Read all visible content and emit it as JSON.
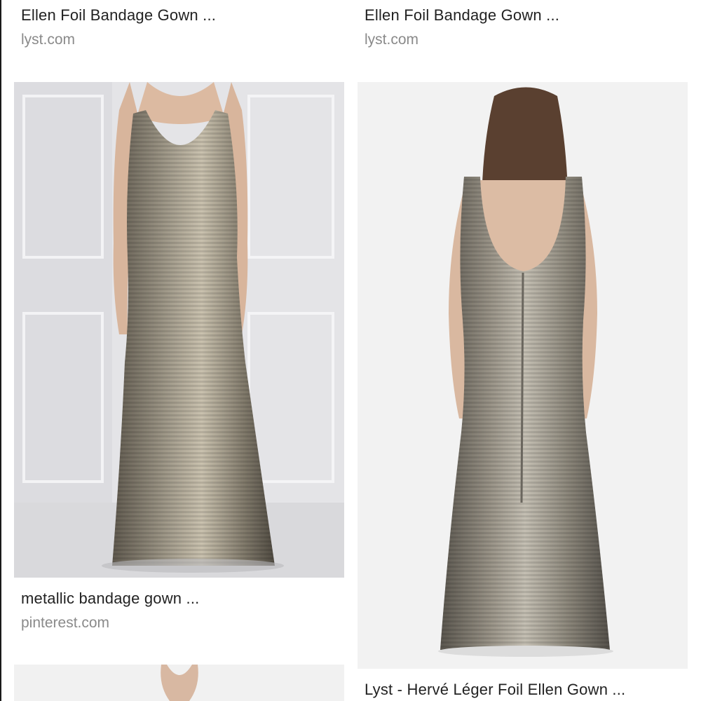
{
  "results": [
    {
      "title": "Ellen Foil Bandage Gown ...",
      "source": "lyst.com"
    },
    {
      "title": "Ellen Foil Bandage Gown ...",
      "source": "lyst.com"
    },
    {
      "title": "metallic bandage gown ...",
      "source": "pinterest.com"
    },
    {
      "title": "Lyst - Hervé Léger Foil Ellen Gown ..."
    }
  ],
  "colors": {
    "caption": "#222222",
    "source": "#8a8a8a",
    "gown_metal": "#8a8478",
    "photo_bg_left": "#e6e6e8",
    "photo_bg_right": "#f2f2f2"
  }
}
